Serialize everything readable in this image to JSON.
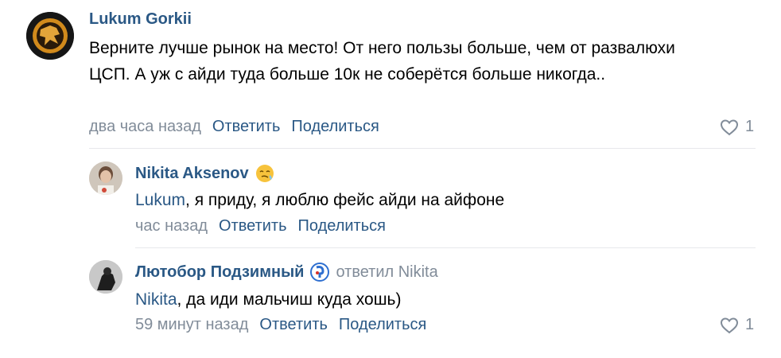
{
  "comments": [
    {
      "author": "Lukum Gorkii",
      "text": "Верните лучше рынок на место! От него пользы больше, чем от развалюхи ЦСП. А уж с айди туда больше 10к не соберётся больше никогда..",
      "time": "два часа назад",
      "reply_label": "Ответить",
      "share_label": "Поделиться",
      "likes": "1"
    },
    {
      "author": "Nikita Aksenov",
      "mention": "Lukum",
      "text": ", я приду, я люблю фейс айди на айфоне",
      "time": "час назад",
      "reply_label": "Ответить",
      "share_label": "Поделиться"
    },
    {
      "author": "Лютобор Подзимный",
      "replied_to": "ответил Nikita",
      "mention": "Nikita",
      "text": ", да иди мальчиш куда хошь)",
      "time": "59 минут назад",
      "reply_label": "Ответить",
      "share_label": "Поделиться",
      "likes": "1"
    }
  ],
  "colors": {
    "link": "#2a5885",
    "meta": "#818c99",
    "divider": "#e7e8ec"
  }
}
